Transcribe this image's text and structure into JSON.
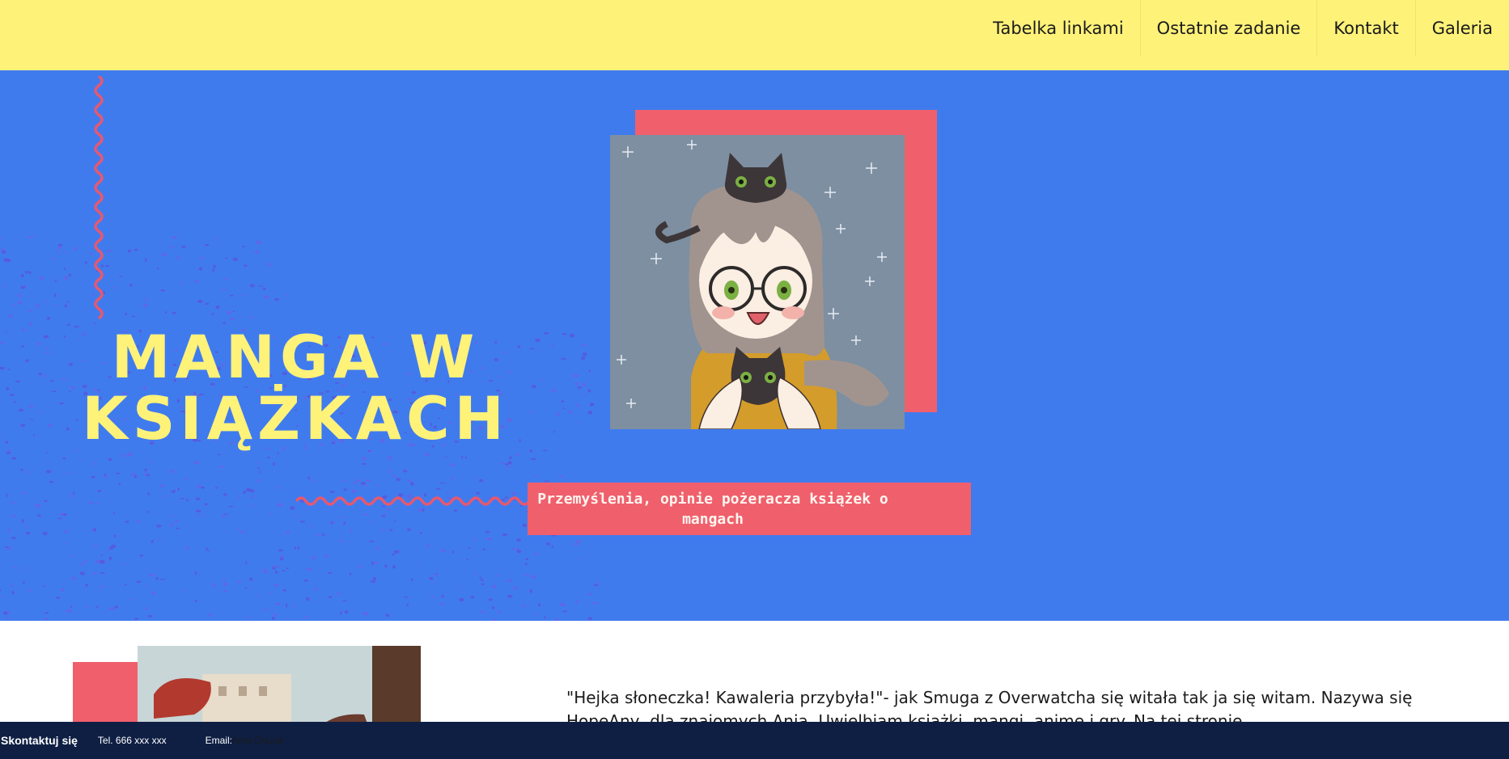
{
  "nav": {
    "items": [
      {
        "label": "Tabelka linkami"
      },
      {
        "label": "Ostatnie zadanie"
      },
      {
        "label": "Kontakt"
      },
      {
        "label": "Galeria"
      }
    ]
  },
  "hero": {
    "title_line1": "MANGA W",
    "title_line2": "KSIĄŻKACH",
    "subtitle": "Przemyślenia, opinie pożeracza książek o mangach",
    "portrait_alt": "anime girl with glasses and two black cats"
  },
  "content": {
    "intro_text": "\"Hejka słoneczka! Kawaleria przybyła!\"- jak Smuga z Overwatcha się witała tak ja się witam. Nazywa się HopeAny, dla znajomych Ania. Uwielbiam książki, mangi, anime i gry. Na tej stronie"
  },
  "footer": {
    "title": "Skontaktuj się",
    "tel": "Tel. 666 xxx xxx",
    "email_label": "Email:",
    "email_value": "Ania Olszak"
  },
  "colors": {
    "nav_bg": "#fef279",
    "hero_bg": "#407bee",
    "accent_pink": "#f05f6c",
    "title_yellow": "#fef279",
    "footer_bg": "#0f1f44"
  }
}
